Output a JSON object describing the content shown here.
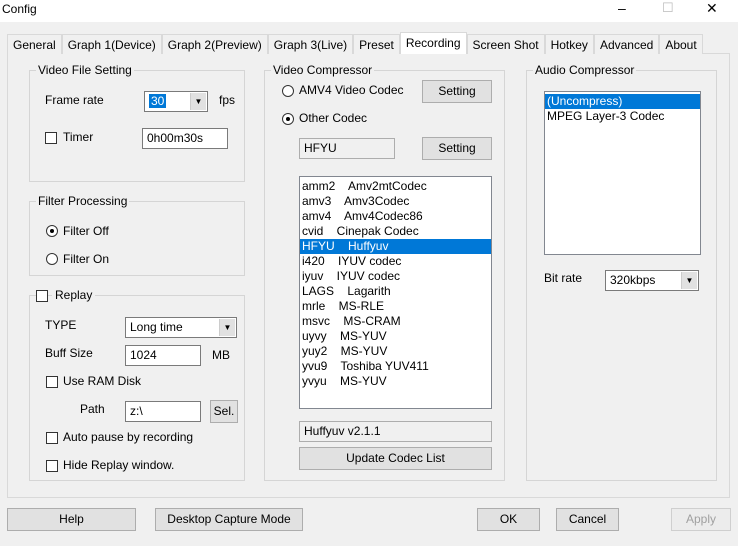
{
  "window": {
    "title": "Config",
    "minimize": "–",
    "maximize": "☐",
    "close": "✕"
  },
  "tabs": [
    "General",
    "Graph 1(Device)",
    "Graph 2(Preview)",
    "Graph 3(Live)",
    "Preset",
    "Recording",
    "Screen Shot",
    "Hotkey",
    "Advanced",
    "About"
  ],
  "active_tab": "Recording",
  "video_file": {
    "title": "Video File Setting",
    "frame_rate_label": "Frame rate",
    "frame_rate": "30",
    "fps": "fps",
    "timer_label": "Timer",
    "timer_value": "0h00m30s"
  },
  "filter": {
    "title": "Filter Processing",
    "off": "Filter Off",
    "on": "Filter On"
  },
  "replay": {
    "title": "Replay",
    "type_label": "TYPE",
    "type_value": "Long time",
    "buff_label": "Buff Size",
    "buff_value": "1024",
    "mb": "MB",
    "ram_disk": "Use RAM Disk",
    "path_label": "Path",
    "path_value": "z:\\",
    "sel": "Sel.",
    "auto_pause": "Auto pause by recording",
    "hide_window": "Hide Replay window."
  },
  "video_comp": {
    "title": "Video Compressor",
    "amv4": "AMV4 Video Codec",
    "other": "Other Codec",
    "setting": "Setting",
    "codec": "HFYU",
    "codecs": [
      "amm2    Amv2mtCodec",
      "amv3    Amv3Codec",
      "amv4    Amv4Codec86",
      "cvid    Cinepak Codec",
      "HFYU    Huffyuv",
      "i420    IYUV codec",
      "iyuv    IYUV codec",
      "LAGS    Lagarith",
      "mrle    MS-RLE",
      "msvc    MS-CRAM",
      "uyvy    MS-YUV",
      "yuy2    MS-YUV",
      "yvu9    Toshiba YUV411",
      "yvyu    MS-YUV"
    ],
    "selected_index": 4,
    "version": "Huffyuv v2.1.1",
    "update": "Update Codec List"
  },
  "audio_comp": {
    "title": "Audio Compressor",
    "codecs": [
      "(Uncompress)",
      "MPEG Layer-3 Codec"
    ],
    "selected_index": 0,
    "bitrate_label": "Bit rate",
    "bitrate": "320kbps"
  },
  "buttons": {
    "help": "Help",
    "desktop": "Desktop Capture Mode",
    "ok": "OK",
    "cancel": "Cancel",
    "apply": "Apply"
  }
}
